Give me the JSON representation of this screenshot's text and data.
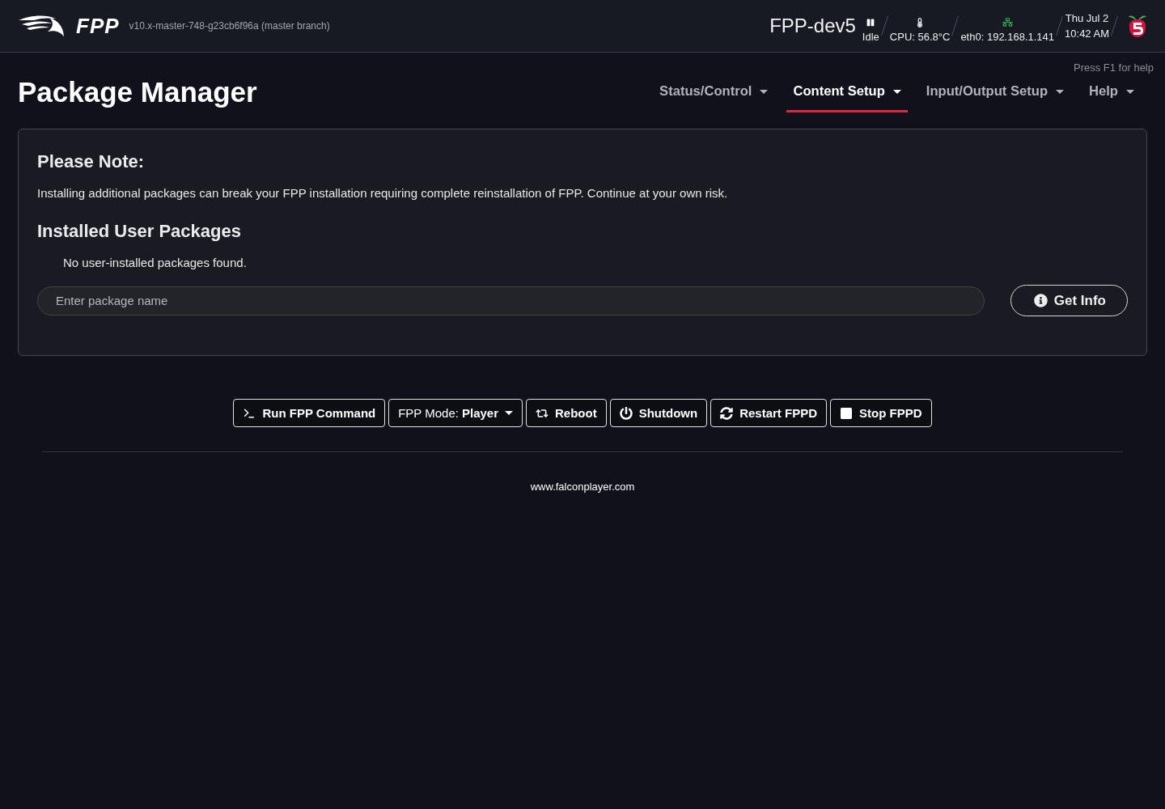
{
  "header": {
    "logo_text": "FPP",
    "version": "v10.x-master-748-g23cb6f96a (master branch)",
    "hostname": "FPP-dev5",
    "status": "Idle",
    "cpu": "CPU: 56.8°C",
    "network": "eth0: 192.168.1.141",
    "date": "Thu Jul 2",
    "time": "10:42 AM"
  },
  "help_hint": "Press F1 for help",
  "page_title": "Package Manager",
  "nav": [
    {
      "label": "Status/Control",
      "selected": false
    },
    {
      "label": "Content Setup",
      "selected": true
    },
    {
      "label": "Input/Output Setup",
      "selected": false
    },
    {
      "label": "Help",
      "selected": false
    }
  ],
  "notice": {
    "heading": "Please Note:",
    "text": "Installing additional packages can break your FPP installation requiring complete reinstallation of FPP. Continue at your own risk."
  },
  "packages": {
    "heading": "Installed User Packages",
    "empty_message": "No user-installed packages found.",
    "search": {
      "placeholder": "Enter package name"
    },
    "button": "Get Info"
  },
  "actions": [
    {
      "kind": "command",
      "label": "Run FPP Command"
    },
    {
      "kind": "mode",
      "label": "FPP Mode:",
      "value": "Player"
    },
    {
      "kind": "reboot",
      "label": "Reboot"
    },
    {
      "kind": "shutdown",
      "label": "Shutdown"
    },
    {
      "kind": "restart",
      "label": "Restart FPPD"
    },
    {
      "kind": "stop",
      "label": "Stop FPPD"
    }
  ],
  "footer": {
    "link": "www.falconplayer.com"
  }
}
